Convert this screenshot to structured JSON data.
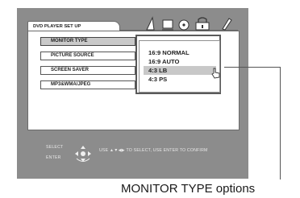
{
  "setup": {
    "title": "DVD PLAYER SET UP",
    "menu_items": [
      "MONITOR TYPE",
      "PICTURE SOURCE",
      "SCREEN SAVER",
      "MP3&WMA/JPEG"
    ],
    "selected_menu_index": 0
  },
  "monitor_type_options": [
    "16:9 NORMAL",
    "16:9 AUTO",
    "4:3 LB",
    "4:3 PS"
  ],
  "highlighted_option_index": 2,
  "footer": {
    "select_label": "SELECT",
    "enter_label": "ENTER",
    "instruction": "USE ▲▼◀▶ TO SELECT, USE ENTER TO CONFIRM"
  },
  "caption": "MONITOR TYPE options",
  "tab_icons": [
    "speaker-tab-icon",
    "display-tab-icon",
    "disc-tab-icon",
    "lock-tab-icon",
    "pen-tab-icon"
  ],
  "colors": {
    "panel": "#8c8c8c",
    "highlight": "#c8c8c8"
  }
}
